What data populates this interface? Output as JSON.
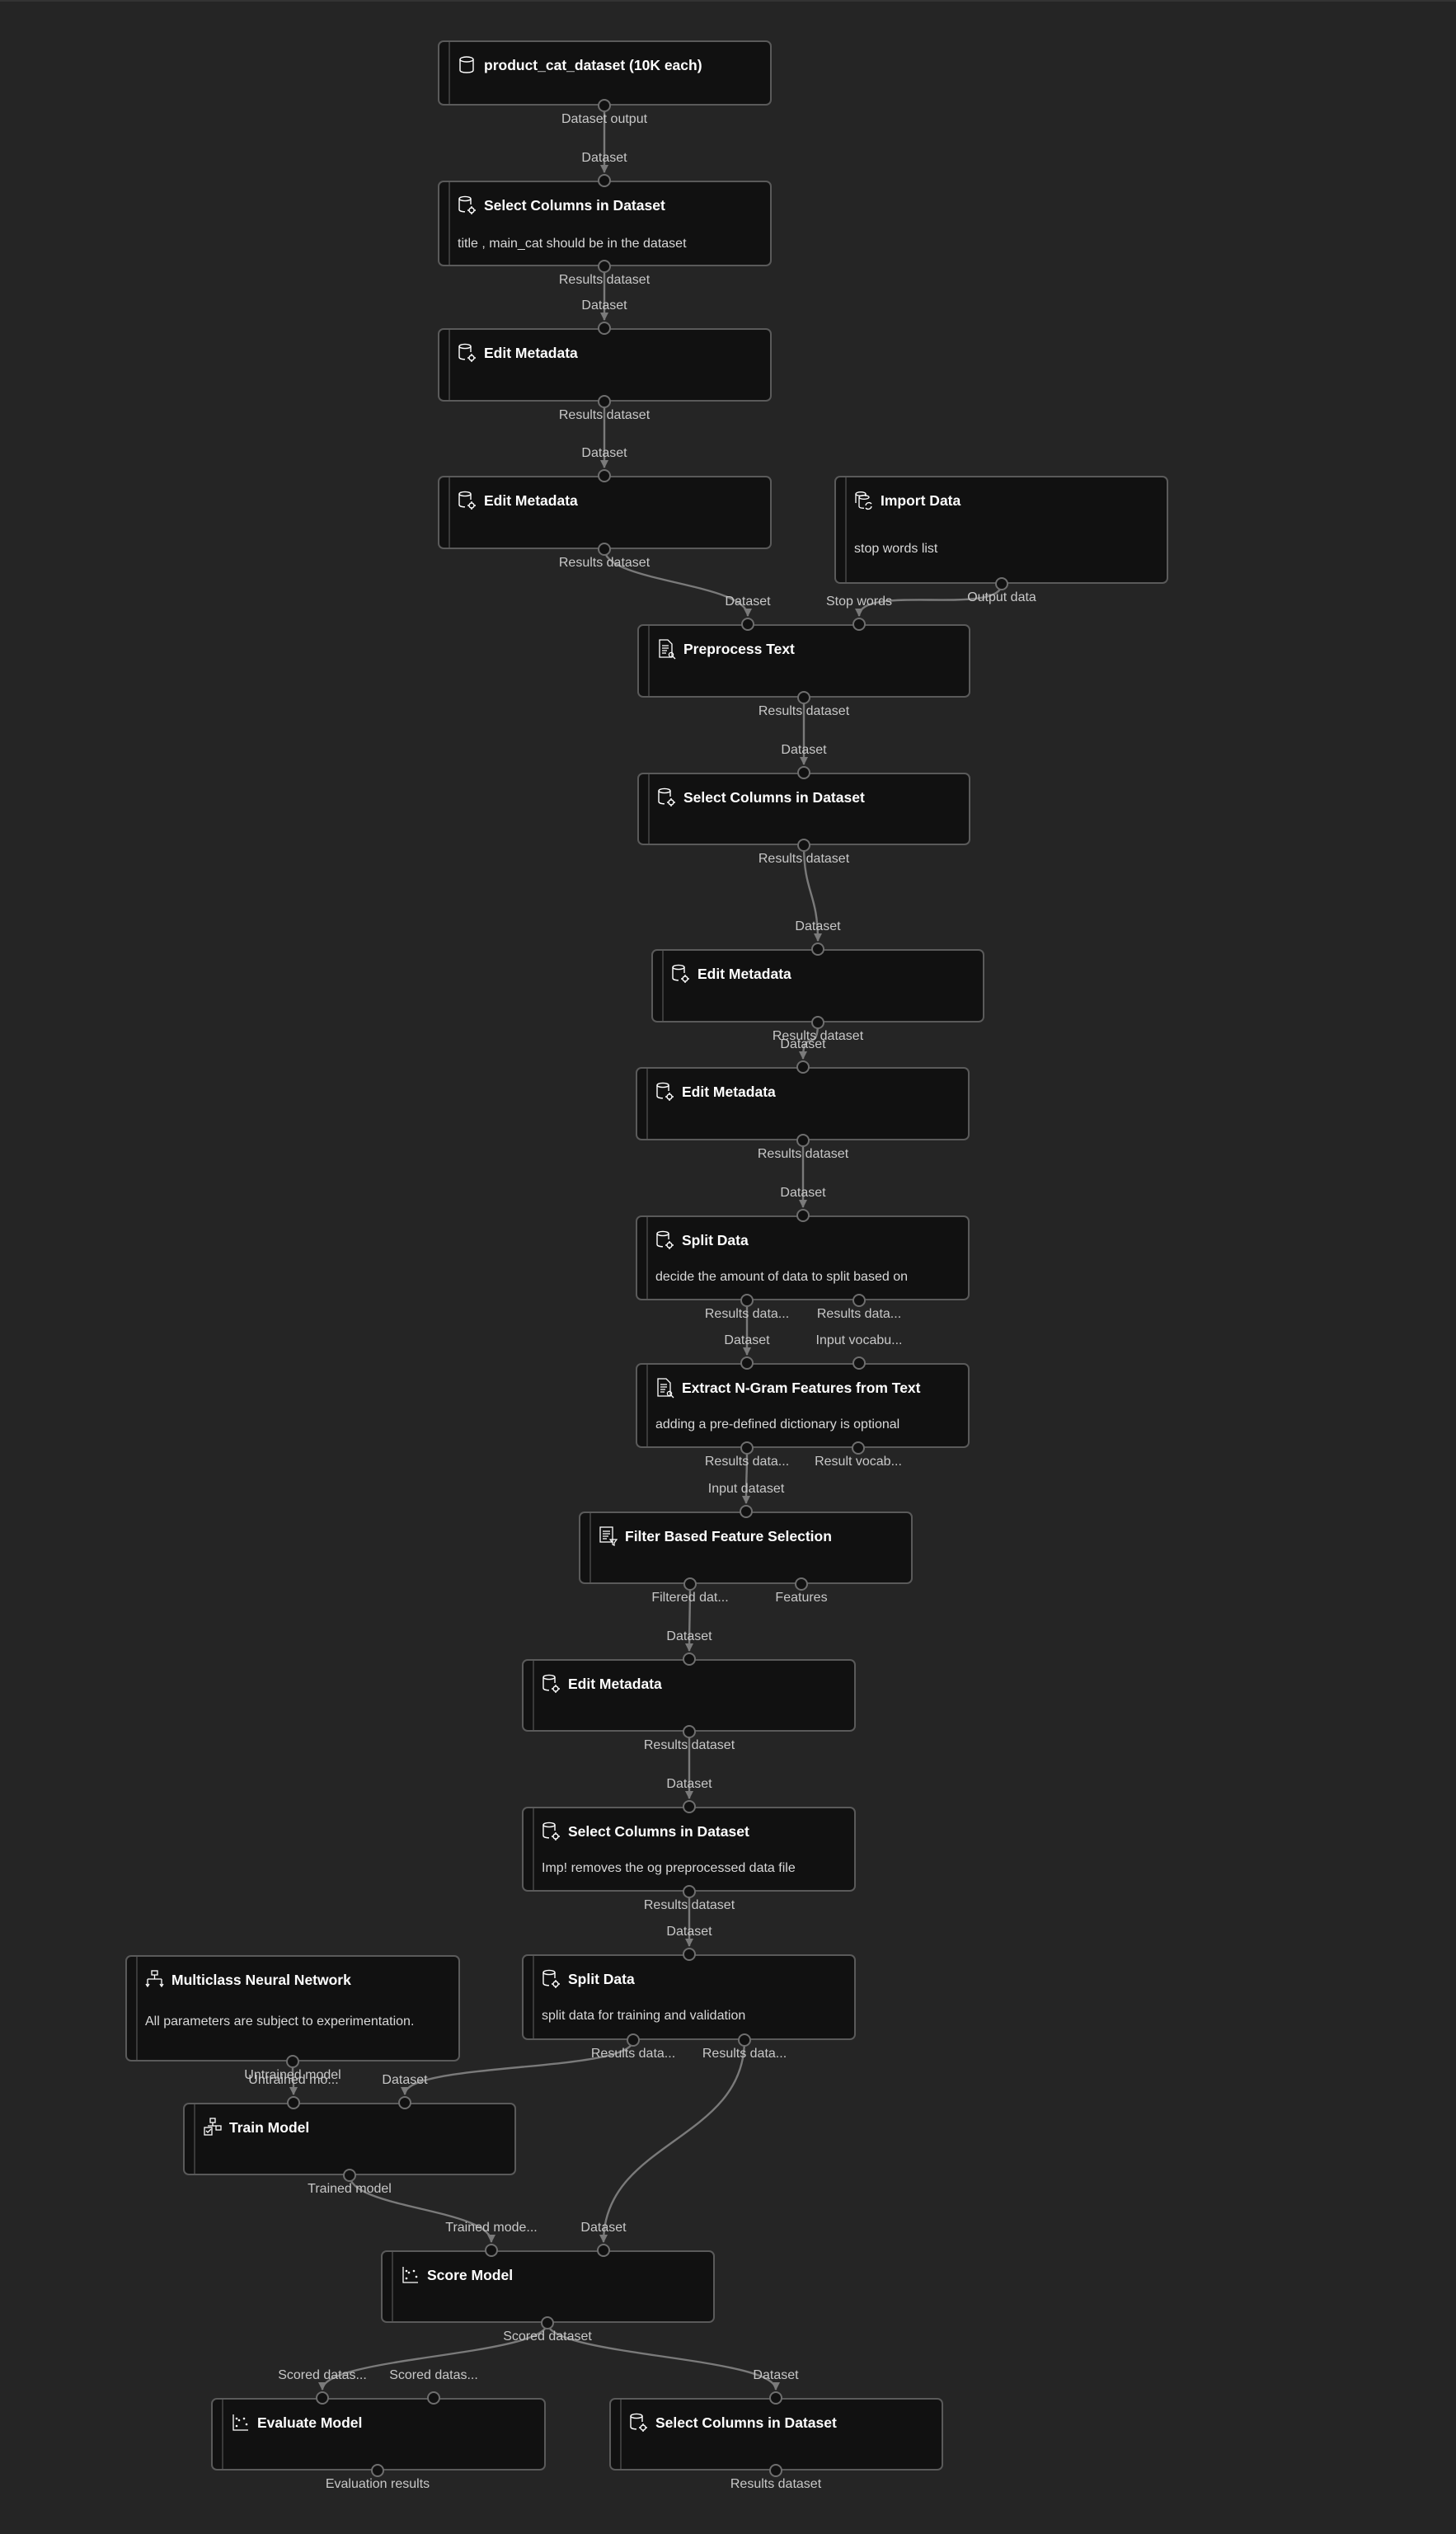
{
  "canvas": {
    "background": "#252525",
    "node_fill": "#111111",
    "node_border": "#5a5a5a",
    "link_color": "#7a7a7a"
  },
  "nodes": [
    {
      "id": "n1",
      "title": "product_cat_dataset (10K each)",
      "icon": "dataset-icon",
      "description": "",
      "inputs": [],
      "outputs": [
        "Dataset output"
      ]
    },
    {
      "id": "n2",
      "title": "Select Columns in Dataset",
      "icon": "dataset-gear-icon",
      "description": "title , main_cat should be in the dataset",
      "inputs": [
        "Dataset"
      ],
      "outputs": [
        "Results dataset"
      ]
    },
    {
      "id": "n3",
      "title": "Edit Metadata",
      "icon": "dataset-gear-icon",
      "description": "",
      "inputs": [
        "Dataset"
      ],
      "outputs": [
        "Results dataset"
      ]
    },
    {
      "id": "n4",
      "title": "Edit Metadata",
      "icon": "dataset-gear-icon",
      "description": "",
      "inputs": [
        "Dataset"
      ],
      "outputs": [
        "Results dataset"
      ]
    },
    {
      "id": "imp",
      "title": "Import Data",
      "icon": "import-data-icon",
      "description": "stop words list",
      "inputs": [],
      "outputs": [
        "Output data"
      ]
    },
    {
      "id": "n5",
      "title": "Preprocess Text",
      "icon": "text-document-icon",
      "description": "",
      "inputs": [
        "Dataset",
        "Stop words"
      ],
      "outputs": [
        "Results dataset"
      ]
    },
    {
      "id": "n6",
      "title": "Select Columns in Dataset",
      "icon": "dataset-gear-icon",
      "description": "",
      "inputs": [
        "Dataset"
      ],
      "outputs": [
        "Results dataset"
      ]
    },
    {
      "id": "n7",
      "title": "Edit Metadata",
      "icon": "dataset-gear-icon",
      "description": "",
      "inputs": [
        "Dataset"
      ],
      "outputs": [
        "Results dataset"
      ]
    },
    {
      "id": "n8",
      "title": "Edit Metadata",
      "icon": "dataset-gear-icon",
      "description": "",
      "inputs": [
        "Dataset"
      ],
      "outputs": [
        "Results dataset"
      ]
    },
    {
      "id": "n9",
      "title": "Split Data",
      "icon": "dataset-gear-icon",
      "description": "decide the amount of data to split based on",
      "inputs": [
        "Dataset"
      ],
      "outputs": [
        "Results data...",
        "Results data..."
      ]
    },
    {
      "id": "n10",
      "title": "Extract N-Gram Features from Text",
      "icon": "text-document-icon",
      "description": "adding a pre-defined dictionary is optional",
      "inputs": [
        "Dataset",
        "Input vocabu..."
      ],
      "outputs": [
        "Results data...",
        "Result vocab..."
      ]
    },
    {
      "id": "n11",
      "title": "Filter Based Feature Selection",
      "icon": "filter-list-icon",
      "description": "",
      "inputs": [
        "Input dataset"
      ],
      "outputs": [
        "Filtered dat...",
        "Features"
      ]
    },
    {
      "id": "n12",
      "title": "Edit Metadata",
      "icon": "dataset-gear-icon",
      "description": "",
      "inputs": [
        "Dataset"
      ],
      "outputs": [
        "Results dataset"
      ]
    },
    {
      "id": "n13",
      "title": "Select Columns in Dataset",
      "icon": "dataset-gear-icon",
      "description": "Imp! removes the og preprocessed data file",
      "inputs": [
        "Dataset"
      ],
      "outputs": [
        "Results dataset"
      ]
    },
    {
      "id": "n14",
      "title": "Split Data",
      "icon": "dataset-gear-icon",
      "description": "split data for training and validation",
      "inputs": [
        "Dataset"
      ],
      "outputs": [
        "Results data...",
        "Results data..."
      ]
    },
    {
      "id": "mnn",
      "title": "Multiclass Neural Network",
      "icon": "neural-network-icon",
      "description": "All parameters are subject to experimentation.",
      "inputs": [],
      "outputs": [
        "Untrained model"
      ]
    },
    {
      "id": "train",
      "title": "Train Model",
      "icon": "train-model-icon",
      "description": "",
      "inputs": [
        "Untrained mo...",
        "Dataset"
      ],
      "outputs": [
        "Trained model"
      ]
    },
    {
      "id": "score",
      "title": "Score Model",
      "icon": "scatter-chart-icon",
      "description": "",
      "inputs": [
        "Trained mode...",
        "Dataset"
      ],
      "outputs": [
        "Scored dataset"
      ]
    },
    {
      "id": "eval",
      "title": "Evaluate Model",
      "icon": "scatter-chart-icon",
      "description": "",
      "inputs": [
        "Scored datas...",
        "Scored datas..."
      ],
      "outputs": [
        "Evaluation results"
      ]
    },
    {
      "id": "n15",
      "title": "Select Columns in Dataset",
      "icon": "dataset-gear-icon",
      "description": "",
      "inputs": [
        "Dataset"
      ],
      "outputs": [
        "Results dataset"
      ]
    }
  ],
  "links": [
    {
      "from": "n1.0",
      "to": "n2.0"
    },
    {
      "from": "n2.0",
      "to": "n3.0"
    },
    {
      "from": "n3.0",
      "to": "n4.0"
    },
    {
      "from": "n4.0",
      "to": "n5.0"
    },
    {
      "from": "imp.0",
      "to": "n5.1"
    },
    {
      "from": "n5.0",
      "to": "n6.0"
    },
    {
      "from": "n6.0",
      "to": "n7.0"
    },
    {
      "from": "n7.0",
      "to": "n8.0"
    },
    {
      "from": "n8.0",
      "to": "n9.0"
    },
    {
      "from": "n9.0",
      "to": "n10.0"
    },
    {
      "from": "n10.0",
      "to": "n11.0"
    },
    {
      "from": "n11.0",
      "to": "n12.0"
    },
    {
      "from": "n12.0",
      "to": "n13.0"
    },
    {
      "from": "n13.0",
      "to": "n14.0"
    },
    {
      "from": "mnn.0",
      "to": "train.0"
    },
    {
      "from": "n14.0",
      "to": "train.1"
    },
    {
      "from": "train.0",
      "to": "score.0"
    },
    {
      "from": "n14.1",
      "to": "score.1"
    },
    {
      "from": "score.0",
      "to": "eval.0"
    },
    {
      "from": "score.0",
      "to": "n15.0"
    }
  ]
}
